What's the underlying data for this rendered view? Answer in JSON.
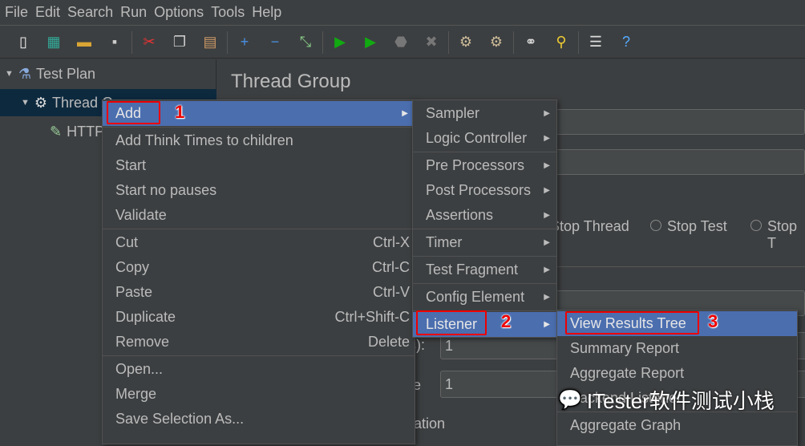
{
  "menubar": [
    "File",
    "Edit",
    "Search",
    "Run",
    "Options",
    "Tools",
    "Help"
  ],
  "toolbar": [
    {
      "icon": "new-icon",
      "g": "▯",
      "c": "#eee"
    },
    {
      "icon": "templates-icon",
      "g": "▦",
      "c": "#3a9"
    },
    {
      "icon": "open-icon",
      "g": "▬",
      "c": "#d9a534"
    },
    {
      "icon": "save-icon",
      "g": "▪",
      "c": "#ccc"
    },
    "|",
    {
      "icon": "cut-icon",
      "g": "✂",
      "c": "#e33"
    },
    {
      "icon": "copy-icon",
      "g": "❐",
      "c": "#ccc"
    },
    {
      "icon": "paste-icon",
      "g": "▤",
      "c": "#c96"
    },
    "|",
    {
      "icon": "expand-icon",
      "g": "+",
      "c": "#4a90e2"
    },
    {
      "icon": "collapse-icon",
      "g": "−",
      "c": "#4a90e2"
    },
    {
      "icon": "toggle-icon",
      "g": "⤡",
      "c": "#8c8"
    },
    "|",
    {
      "icon": "start-icon",
      "g": "▶",
      "c": "#1a1"
    },
    {
      "icon": "start-no-pauses-icon",
      "g": "▶",
      "c": "#1a1"
    },
    {
      "icon": "stop-icon",
      "g": "⬣",
      "c": "#777"
    },
    {
      "icon": "shutdown-icon",
      "g": "✖",
      "c": "#777"
    },
    "|",
    {
      "icon": "clear-icon",
      "g": "⚙",
      "c": "#cb9"
    },
    {
      "icon": "clear-all-icon",
      "g": "⚙",
      "c": "#cb9"
    },
    "|",
    {
      "icon": "search-icon",
      "g": "⚭",
      "c": "#ddd"
    },
    {
      "icon": "reset-search-icon",
      "g": "⚲",
      "c": "#ec3"
    },
    "|",
    {
      "icon": "function-helper-icon",
      "g": "☰",
      "c": "#ddd"
    },
    {
      "icon": "help-icon",
      "g": "?",
      "c": "#5af"
    }
  ],
  "tree": {
    "test_plan": "Test Plan",
    "thread_group": "Thread G",
    "http": "HTTP"
  },
  "editor": {
    "title": "Thread Group",
    "stop_thread": "Stop Thread",
    "stop_test": "Stop Test",
    "stop_t": "Stop T",
    "label1": "s):",
    "value1": "1",
    "label2": "te",
    "value2": "1",
    "label3": "ration"
  },
  "context_menu": {
    "groups": [
      [
        {
          "label": "Add",
          "arrow": true,
          "hl": true
        }
      ],
      [
        {
          "label": "Add Think Times to children"
        },
        {
          "label": "Start"
        },
        {
          "label": "Start no pauses"
        },
        {
          "label": "Validate"
        }
      ],
      [
        {
          "label": "Cut",
          "sc": "Ctrl-X"
        },
        {
          "label": "Copy",
          "sc": "Ctrl-C"
        },
        {
          "label": "Paste",
          "sc": "Ctrl-V"
        },
        {
          "label": "Duplicate",
          "sc": "Ctrl+Shift-C"
        },
        {
          "label": "Remove",
          "sc": "Delete"
        }
      ],
      [
        {
          "label": "Open..."
        },
        {
          "label": "Merge"
        },
        {
          "label": "Save Selection As..."
        }
      ]
    ]
  },
  "add_menu": {
    "items": [
      {
        "label": "Sampler"
      },
      {
        "label": "Logic Controller"
      },
      "-",
      {
        "label": "Pre Processors"
      },
      {
        "label": "Post Processors"
      },
      {
        "label": "Assertions"
      },
      "-",
      {
        "label": "Timer"
      },
      "-",
      {
        "label": "Test Fragment"
      },
      "-",
      {
        "label": "Config Element"
      },
      "-",
      {
        "label": "Listener",
        "hl": true
      }
    ]
  },
  "listener_menu": {
    "items": [
      {
        "label": "View Results Tree",
        "hl": true
      },
      {
        "label": "Summary Report"
      },
      {
        "label": "Aggregate Report"
      },
      {
        "label": "Backend Listener"
      },
      "-",
      {
        "label": "Aggregate Graph"
      }
    ]
  },
  "annotations": [
    "1",
    "2",
    "3"
  ],
  "watermark": "ITester软件测试小栈",
  "colors": {
    "highlight": "#4b6eaf",
    "annotation": "#ee0000"
  }
}
